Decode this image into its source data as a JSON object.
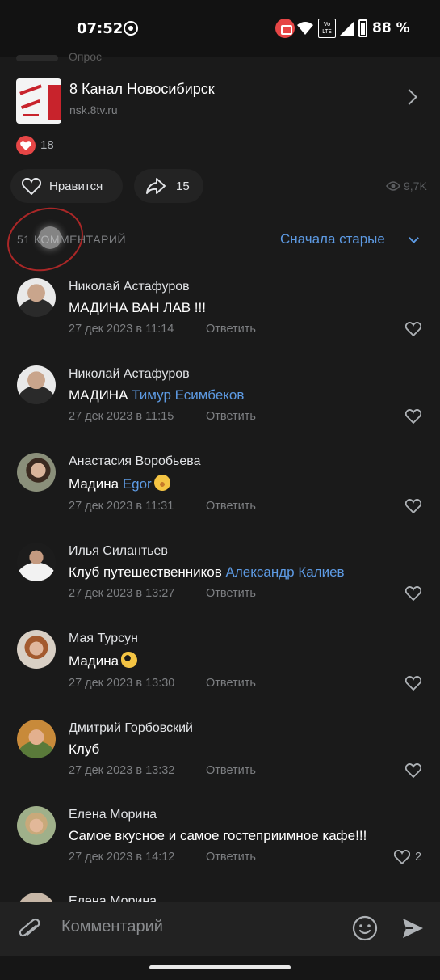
{
  "status_bar": {
    "time": "07:52",
    "volte_top": "Vo",
    "volte_bottom": "LTE",
    "battery": "88 %"
  },
  "previous_block": {
    "cut_text": "Опрос"
  },
  "attachment": {
    "title": "8 Канал Новосибирск",
    "url": "nsk.8tv.ru"
  },
  "reactions": {
    "count": "18"
  },
  "actions": {
    "like_label": "Нравится",
    "share_count": "15",
    "views": "9,7K"
  },
  "comments_header": {
    "count_label": "51 КОММЕНТАРИЙ",
    "sort_label": "Сначала старые"
  },
  "comments": [
    {
      "author": "Николай Астафуров",
      "text": "МАДИНА ВАН ЛАВ !!!",
      "mention": "",
      "date": "27 дек 2023 в 11:14",
      "reply": "Ответить",
      "likes": ""
    },
    {
      "author": "Николай Астафуров",
      "text": "МАДИНА",
      "mention": "Тимур Есимбеков",
      "date": "27 дек 2023 в 11:15",
      "reply": "Ответить",
      "likes": ""
    },
    {
      "author": "Анастасия Воробьева",
      "text": "Мадина",
      "mention": "Egor",
      "date": "27 дек 2023 в 11:31",
      "reply": "Ответить",
      "likes": ""
    },
    {
      "author": "Илья Силантьев",
      "text": "Клуб путешественников",
      "mention": "Александр Калиев",
      "date": "27 дек 2023 в 13:27",
      "reply": "Ответить",
      "likes": ""
    },
    {
      "author": "Мая Турсун",
      "text": "Мадина",
      "mention": "",
      "date": "27 дек 2023 в 13:30",
      "reply": "Ответить",
      "likes": ""
    },
    {
      "author": "Дмитрий Горбовский",
      "text": "Клуб",
      "mention": "",
      "date": "27 дек 2023 в 13:32",
      "reply": "Ответить",
      "likes": ""
    },
    {
      "author": "Елена Морина",
      "text": "Самое вкусное и самое гостеприимное кафе!!!",
      "mention": "",
      "date": "27 дек 2023 в 14:12",
      "reply": "Ответить",
      "likes": "2"
    }
  ],
  "cutoff_comment": {
    "author": "Елена Морина"
  },
  "composer": {
    "placeholder": "Комментарий"
  },
  "colors": {
    "background": "#1a1a1a",
    "accent": "#5d9ae3",
    "heart": "#e64646"
  }
}
